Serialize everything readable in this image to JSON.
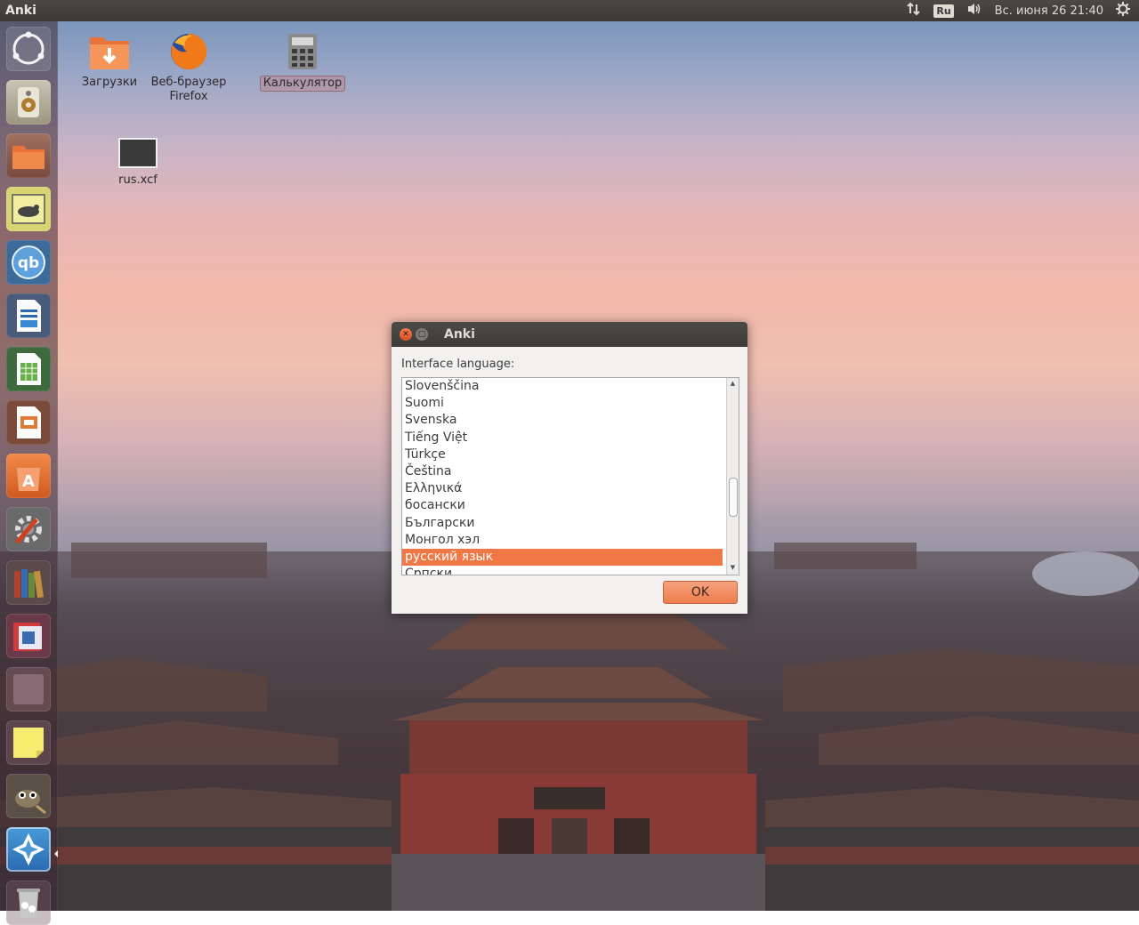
{
  "top_panel": {
    "app_title": "Anki",
    "keyboard_layout": "Ru",
    "datetime": "Вс. июня 26 21:40"
  },
  "launcher": {
    "items": [
      {
        "name": "dash-home-icon"
      },
      {
        "name": "audio-player-icon"
      },
      {
        "name": "files-icon"
      },
      {
        "name": "gallery-icon"
      },
      {
        "name": "qbittorrent-icon"
      },
      {
        "name": "writer-icon"
      },
      {
        "name": "calc-spreadsheet-icon"
      },
      {
        "name": "impress-icon"
      },
      {
        "name": "software-center-icon"
      },
      {
        "name": "system-settings-icon"
      },
      {
        "name": "library-icon"
      },
      {
        "name": "presentation-icon"
      },
      {
        "name": "workspaces-icon"
      },
      {
        "name": "sticky-notes-icon"
      },
      {
        "name": "gimp-icon"
      },
      {
        "name": "anki-icon"
      },
      {
        "name": "trash-icon"
      }
    ]
  },
  "desktop": {
    "icons": [
      {
        "label": "Загрузки"
      },
      {
        "label": "Веб-браузер Firefox"
      },
      {
        "label": "Калькулятор"
      },
      {
        "label": "rus.xcf"
      }
    ]
  },
  "dialog": {
    "title": "Anki",
    "label": "Interface language:",
    "languages": [
      "Slovenščina",
      "Suomi",
      "Svenska",
      "Tiếng Việt",
      "Türkçe",
      "Čeština",
      "Ελληνικά",
      "босански",
      "Български",
      "Монгол хэл",
      "русский язык",
      "Српски"
    ],
    "selected_language": "русский язык",
    "ok_label": "OK"
  },
  "colors": {
    "selection": "#f07746",
    "panel": "#3c3b37",
    "ok_button": "#ef7c4d"
  }
}
